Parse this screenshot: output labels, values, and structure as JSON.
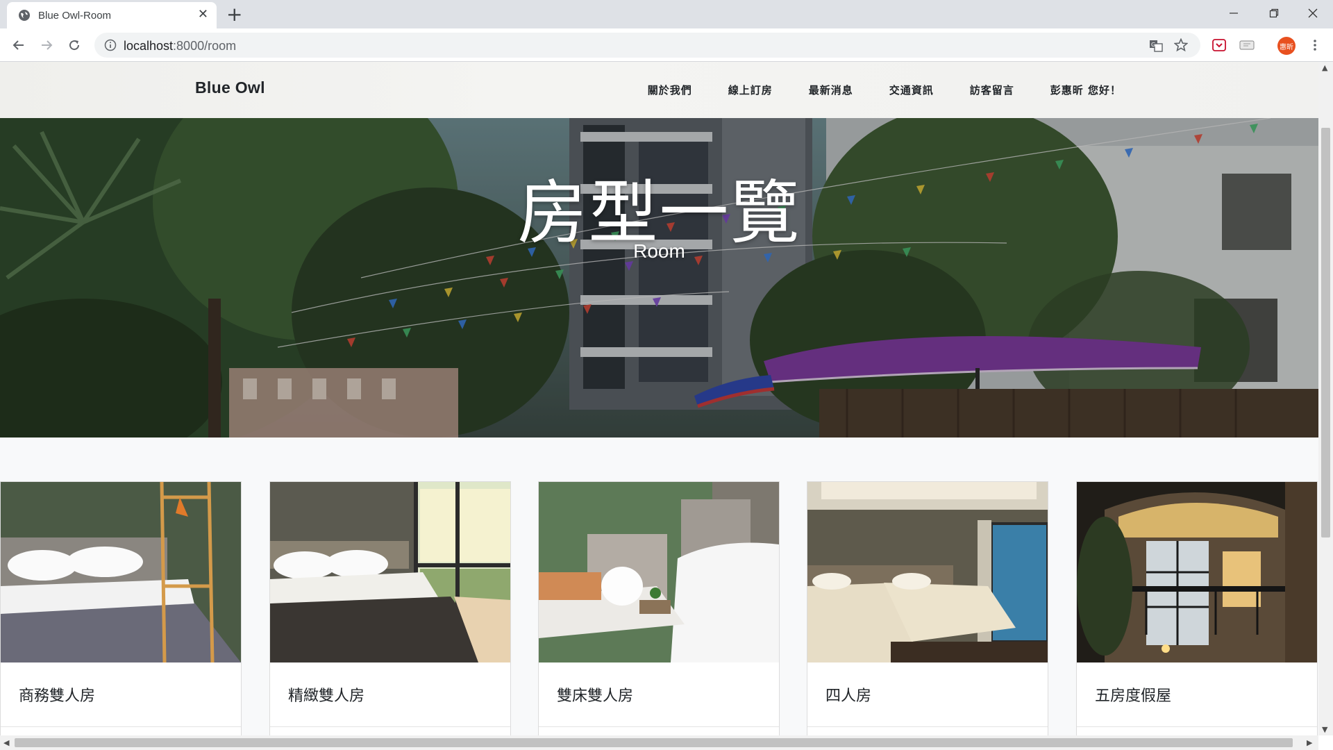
{
  "browser": {
    "tab_title": "Blue Owl-Room",
    "url_host": "localhost",
    "url_path": ":8000/room",
    "profile_initials": "惠昕"
  },
  "site": {
    "brand": "Blue Owl",
    "menu": [
      {
        "label": "關於我們"
      },
      {
        "label": "線上訂房"
      },
      {
        "label": "最新消息"
      },
      {
        "label": "交通資訊"
      },
      {
        "label": "訪客留言"
      },
      {
        "label": "彭惠昕 您好！"
      }
    ]
  },
  "hero": {
    "title": "房型一覽",
    "subtitle": "Room"
  },
  "rooms": [
    {
      "name": "商務雙人房"
    },
    {
      "name": "精緻雙人房"
    },
    {
      "name": "雙床雙人房"
    },
    {
      "name": "四人房"
    },
    {
      "name": "五房度假屋"
    }
  ],
  "colors": {
    "tabbar_bg": "#dee1e6",
    "avatar": "#e8501f",
    "umbrella": "#7b3a9a"
  }
}
